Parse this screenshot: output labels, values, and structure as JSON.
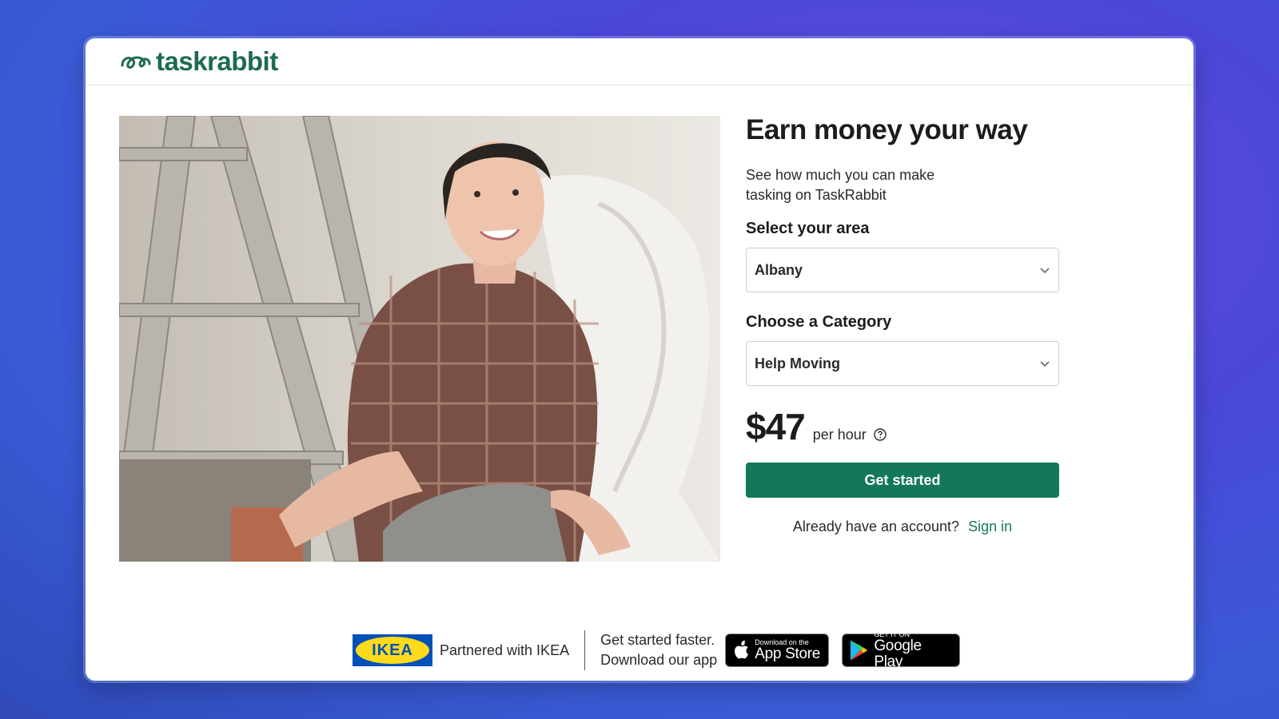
{
  "header": {
    "logo_text": "taskrabbit"
  },
  "main": {
    "title": "Earn money your way",
    "subtitle_line1": "See how much you can make",
    "subtitle_line2": "tasking on TaskRabbit",
    "area": {
      "label": "Select your area",
      "value": "Albany"
    },
    "category": {
      "label": "Choose a Category",
      "value": "Help Moving"
    },
    "price": "$47",
    "price_unit": "per hour",
    "cta_label": "Get started",
    "signin_prompt": "Already have an account?",
    "signin_link": "Sign in"
  },
  "footer": {
    "ikea_logo_text": "IKEA",
    "partner_text": "Partnered with IKEA",
    "app_line1": "Get started faster.",
    "app_line2": "Download our app",
    "appstore_small": "Download on the",
    "appstore_big": "App Store",
    "googleplay_small": "GET IT ON",
    "googleplay_big": "Google Play"
  },
  "colors": {
    "brand_green": "#13785a",
    "logo_green": "#1d6b4f",
    "ikea_blue": "#0051ba",
    "ikea_yellow": "#ffda1a"
  }
}
